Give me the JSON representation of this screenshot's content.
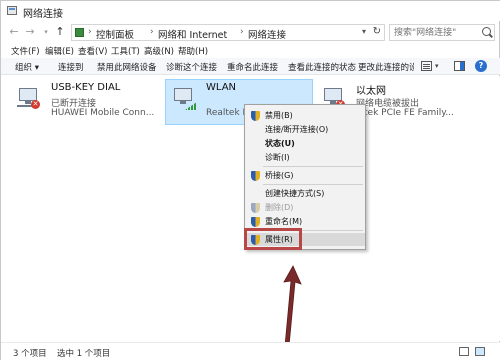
{
  "window": {
    "title": "网络连接"
  },
  "address": {
    "crumbs": [
      "控制面板",
      "网络和 Internet",
      "网络连接"
    ],
    "search_placeholder": "搜索\"网络连接\""
  },
  "menubar": [
    "文件(F)",
    "编辑(E)",
    "查看(V)",
    "工具(T)",
    "高级(N)",
    "帮助(H)"
  ],
  "toolbar": [
    "组织 ▾",
    "连接到",
    "禁用此网络设备",
    "诊断这个连接",
    "重命名此连接",
    "查看此连接的状态",
    "更改此连接的设置"
  ],
  "connections": [
    {
      "name": "USB-KEY DIAL",
      "status": "已断开连接",
      "device": "HUAWEI Mobile Conn...",
      "icon": "disconnected-network-icon"
    },
    {
      "name": "WLAN",
      "status": "",
      "device": "Realtek R",
      "icon": "wifi-network-icon",
      "selected": true
    },
    {
      "name": "以太网",
      "status": "网络电缆被拔出",
      "device": "altek PCIe FE Family...",
      "icon": "ethernet-network-icon"
    }
  ],
  "context_menu": {
    "items": [
      {
        "label": "禁用(B)",
        "shield": true
      },
      {
        "label": "连接/断开连接(O)"
      },
      {
        "label": "状态(U)",
        "bold": true
      },
      {
        "label": "诊断(I)"
      },
      {
        "label": "桥接(G)",
        "shield": true
      },
      {
        "label": "创建快捷方式(S)"
      },
      {
        "label": "删除(D)",
        "shield": true,
        "disabled": true
      },
      {
        "label": "重命名(M)",
        "shield": true
      },
      {
        "label": "属性(R)",
        "shield": true,
        "highlighted": true
      }
    ]
  },
  "statusbar": {
    "count": "3 个项目",
    "selected": "选中 1 个项目"
  },
  "colors": {
    "selection": "#cce8ff",
    "highlight_border": "#b84848",
    "accent": "#2a6fd0"
  }
}
